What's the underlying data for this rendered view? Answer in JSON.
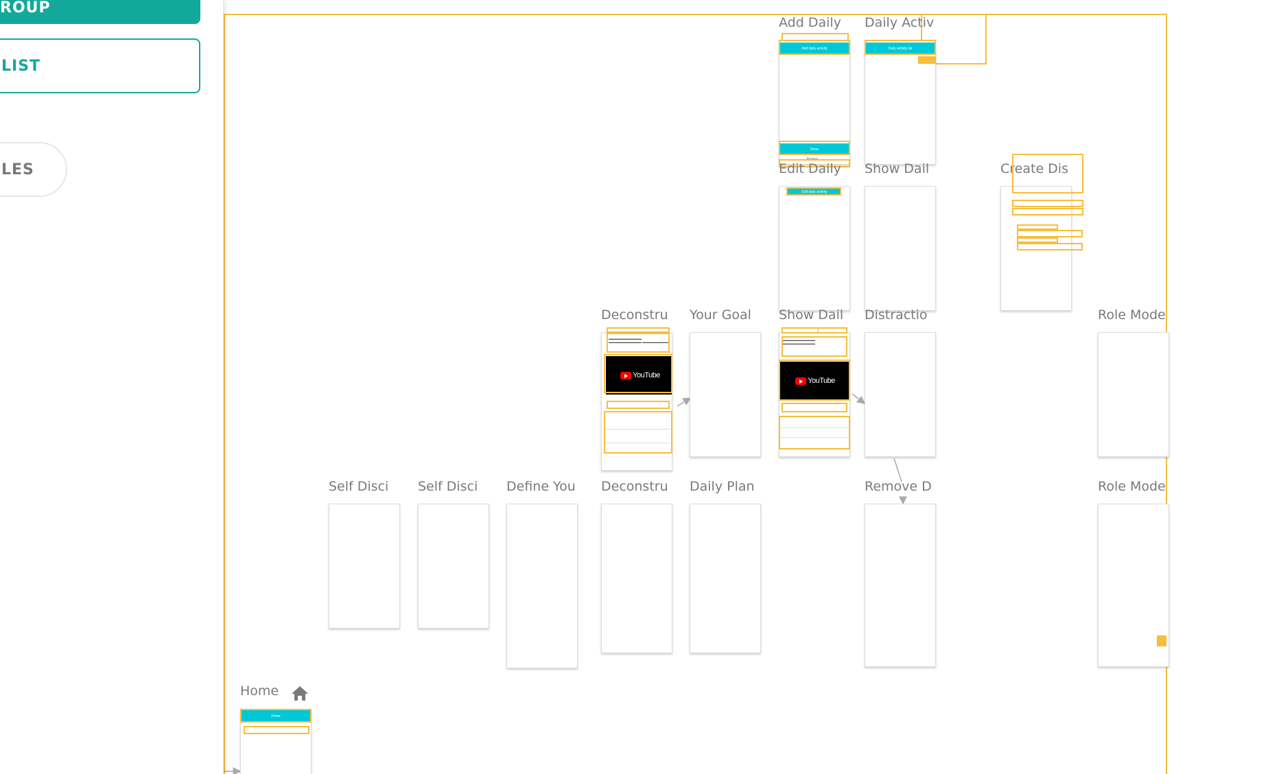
{
  "left_panel": {
    "group_button": "ROUP",
    "list_button": "LIST",
    "les_button": "LES"
  },
  "screens": {
    "add_daily": {
      "label": "Add Daily",
      "bar_title": "Add daily activity",
      "bottom_bar": "Done",
      "field": "Name"
    },
    "daily_activ": {
      "label": "Daily Activ",
      "bar_title": "Daily activity list"
    },
    "edit_daily": {
      "label": "Edit Daily",
      "bar_title": "Edit daily activity"
    },
    "show_dail_top": {
      "label": "Show Dail"
    },
    "create_dis": {
      "label": "Create Dis"
    },
    "deconstru_top": {
      "label": "Deconstru"
    },
    "your_goal": {
      "label": "Your Goal"
    },
    "show_dail_mid": {
      "label": "Show Dail"
    },
    "distractio": {
      "label": "Distractio"
    },
    "role_mode_top": {
      "label": "Role Mode"
    },
    "self_disci_1": {
      "label": "Self Disci"
    },
    "self_disci_2": {
      "label": "Self Disci"
    },
    "define_you": {
      "label": "Define You"
    },
    "deconstru_bottom": {
      "label": "Deconstru"
    },
    "daily_plan": {
      "label": "Daily Plan"
    },
    "remove_d": {
      "label": "Remove D"
    },
    "role_mode_bottom": {
      "label": "Role Mode"
    },
    "home": {
      "label": "Home",
      "bar_title": "Home"
    }
  },
  "youtube_label": "YouTube",
  "icons": {
    "home": "home-icon",
    "arrow": "arrow-right-icon"
  },
  "colors": {
    "accent_teal": "#12a99a",
    "highlight_orange": "#f7bd3b",
    "app_bar_cyan": "#00c8d6"
  }
}
